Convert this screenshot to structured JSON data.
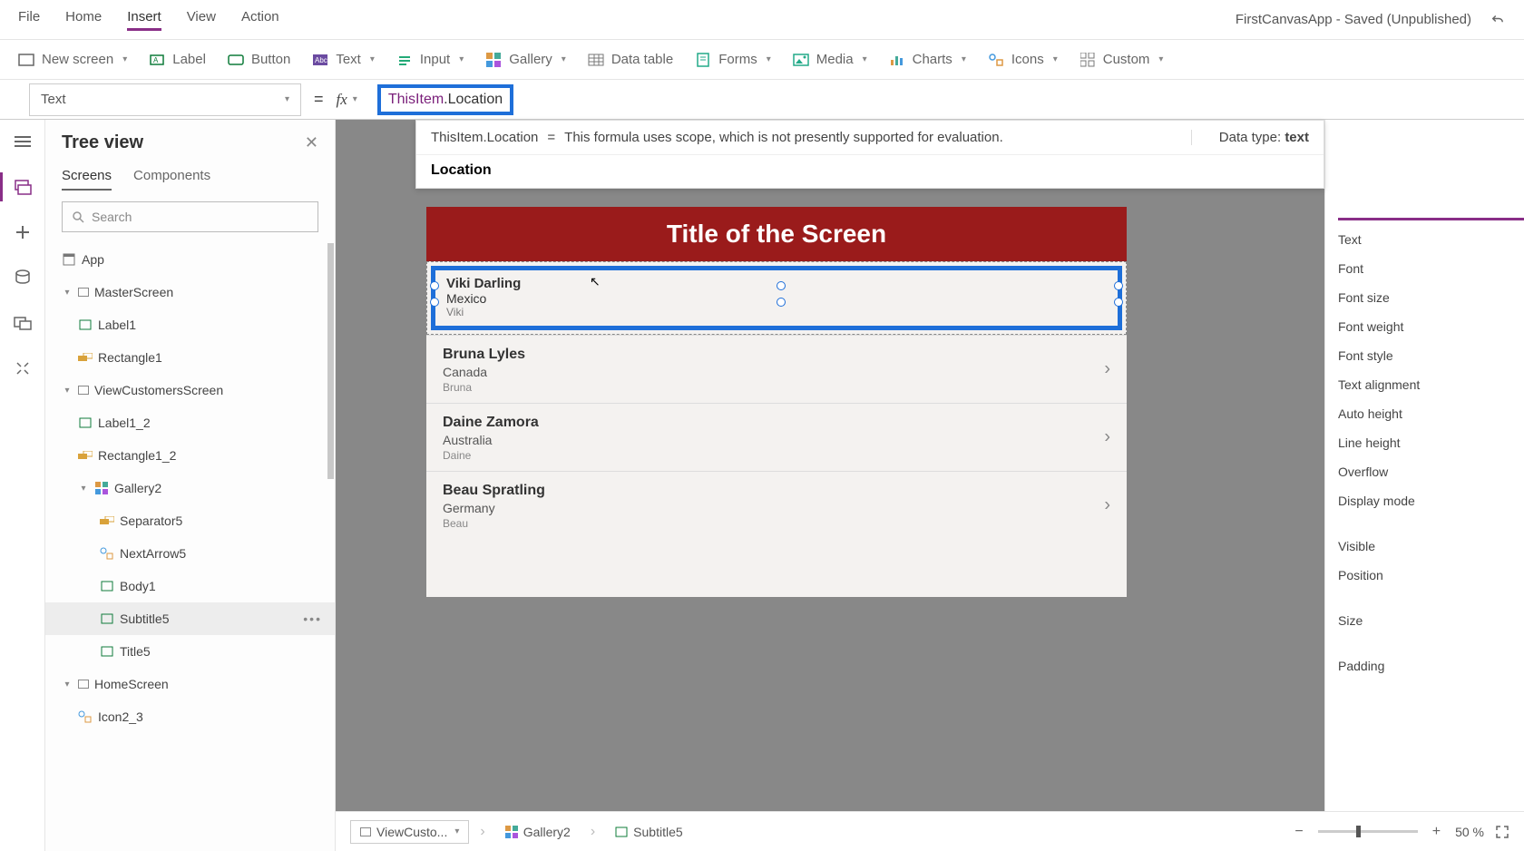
{
  "app": {
    "title": "FirstCanvasApp - Saved (Unpublished)"
  },
  "menubar": {
    "file": "File",
    "home": "Home",
    "insert": "Insert",
    "view": "View",
    "action": "Action"
  },
  "ribbon": {
    "new_screen": "New screen",
    "label": "Label",
    "button": "Button",
    "text": "Text",
    "input": "Input",
    "gallery": "Gallery",
    "data_table": "Data table",
    "forms": "Forms",
    "media": "Media",
    "charts": "Charts",
    "icons": "Icons",
    "custom": "Custom"
  },
  "formula": {
    "property": "Text",
    "expr_this": "ThisItem",
    "expr_dot": ".",
    "expr_field": "Location",
    "intel_formula": "ThisItem.Location",
    "intel_eq": "=",
    "intel_message": "This formula uses scope, which is not presently supported for evaluation.",
    "intel_type_label": "Data type: ",
    "intel_type_value": "text",
    "intel_field": "Location"
  },
  "tree": {
    "title": "Tree view",
    "tab_screens": "Screens",
    "tab_components": "Components",
    "search_placeholder": "Search",
    "nodes": {
      "app": "App",
      "master": "MasterScreen",
      "label1": "Label1",
      "rect1": "Rectangle1",
      "viewcust": "ViewCustomersScreen",
      "label1_2": "Label1_2",
      "rect1_2": "Rectangle1_2",
      "gallery2": "Gallery2",
      "separator5": "Separator5",
      "nextarrow5": "NextArrow5",
      "body1": "Body1",
      "subtitle5": "Subtitle5",
      "title5": "Title5",
      "home": "HomeScreen",
      "icon2_3": "Icon2_3"
    }
  },
  "canvas": {
    "screen_title": "Title of the Screen",
    "items": [
      {
        "name": "Viki Darling",
        "location": "Mexico",
        "sub": "Viki"
      },
      {
        "name": "Bruna Lyles",
        "location": "Canada",
        "sub": "Bruna"
      },
      {
        "name": "Daine Zamora",
        "location": "Australia",
        "sub": "Daine"
      },
      {
        "name": "Beau Spratling",
        "location": "Germany",
        "sub": "Beau"
      }
    ]
  },
  "props": {
    "items": [
      "Text",
      "Font",
      "Font size",
      "Font weight",
      "Font style",
      "Text alignment",
      "Auto height",
      "Line height",
      "Overflow",
      "Display mode",
      "Visible",
      "Position",
      "Size",
      "Padding"
    ]
  },
  "status": {
    "crumb1": "ViewCusto...",
    "crumb2": "Gallery2",
    "crumb3": "Subtitle5",
    "zoom": "50 %"
  }
}
